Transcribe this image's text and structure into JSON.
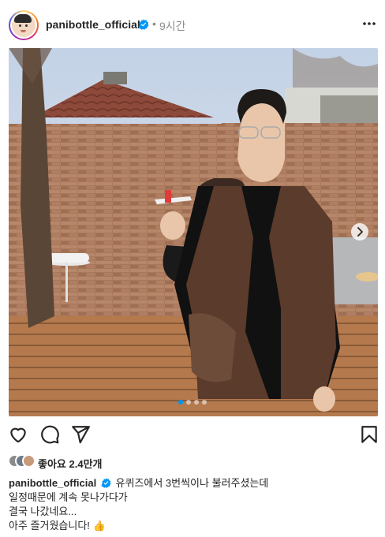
{
  "post": {
    "username": "panibottle_official",
    "separator": "•",
    "time": "9시간",
    "image_count": 4,
    "active_image_index": 0
  },
  "icons": {
    "more": "more-horizontal-icon",
    "verified": "verified-badge-icon",
    "like": "heart-icon",
    "comment": "comment-icon",
    "share": "send-icon",
    "save": "bookmark-icon",
    "next": "chevron-right-icon"
  },
  "likes": {
    "label": "좋아요 2.4만개"
  },
  "caption": {
    "username": "panibottle_official",
    "lines": [
      "유퀴즈에서 3번씩이나 불러주셨는데",
      "일정때문에 계속 못나가다가",
      "결국 나갔네요...",
      "아주 즐거웠습니다! 👍"
    ]
  },
  "colors": {
    "verified": "#0095f6",
    "text": "#262626",
    "muted": "#8e8e8e"
  }
}
